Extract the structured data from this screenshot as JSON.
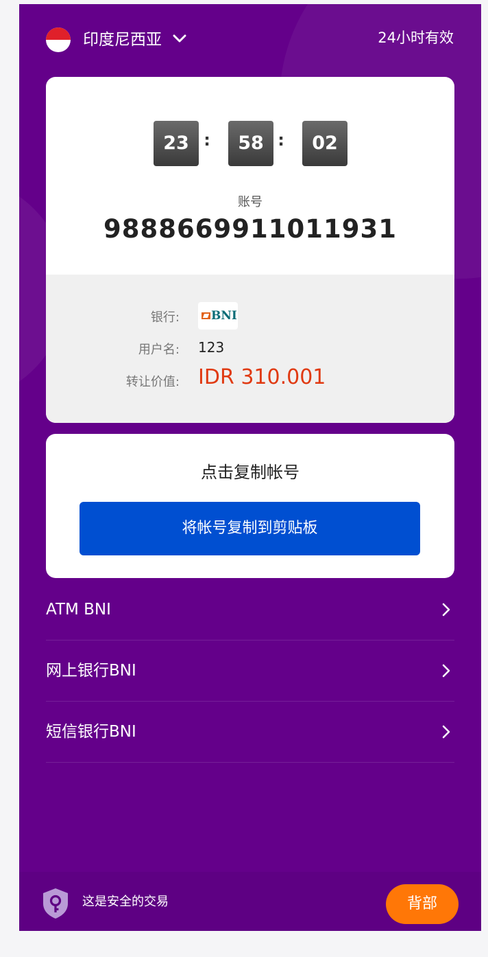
{
  "header": {
    "country": "印度尼西亚",
    "validity": "24小时有效"
  },
  "timer": {
    "hours": "23",
    "minutes": "58",
    "seconds": "02",
    "separator": ":"
  },
  "account": {
    "label": "账号",
    "number": "9888669911011931"
  },
  "details": {
    "bank_label": "银行:",
    "bank_name": "BNI",
    "username_label": "用户名:",
    "username": "123",
    "amount_label": "转让价值:",
    "amount": "IDR 310.001"
  },
  "copy": {
    "title": "点击复制帐号",
    "button_label": "将帐号复制到剪贴板"
  },
  "menu": {
    "items": [
      {
        "label": "ATM BNI"
      },
      {
        "label": "网上银行BNI"
      },
      {
        "label": "短信银行BNI"
      }
    ]
  },
  "footer": {
    "secure_text": "这是安全的交易",
    "back_label": "背部"
  },
  "colors": {
    "background": "#64008a",
    "button": "#004fd1",
    "amount": "#e03a12",
    "back_button": "#ff7707",
    "flag_red": "#e0202a"
  },
  "icons": [
    "indonesia-flag-icon",
    "chevron-down-icon",
    "chevron-right-icon",
    "shield-key-icon"
  ]
}
